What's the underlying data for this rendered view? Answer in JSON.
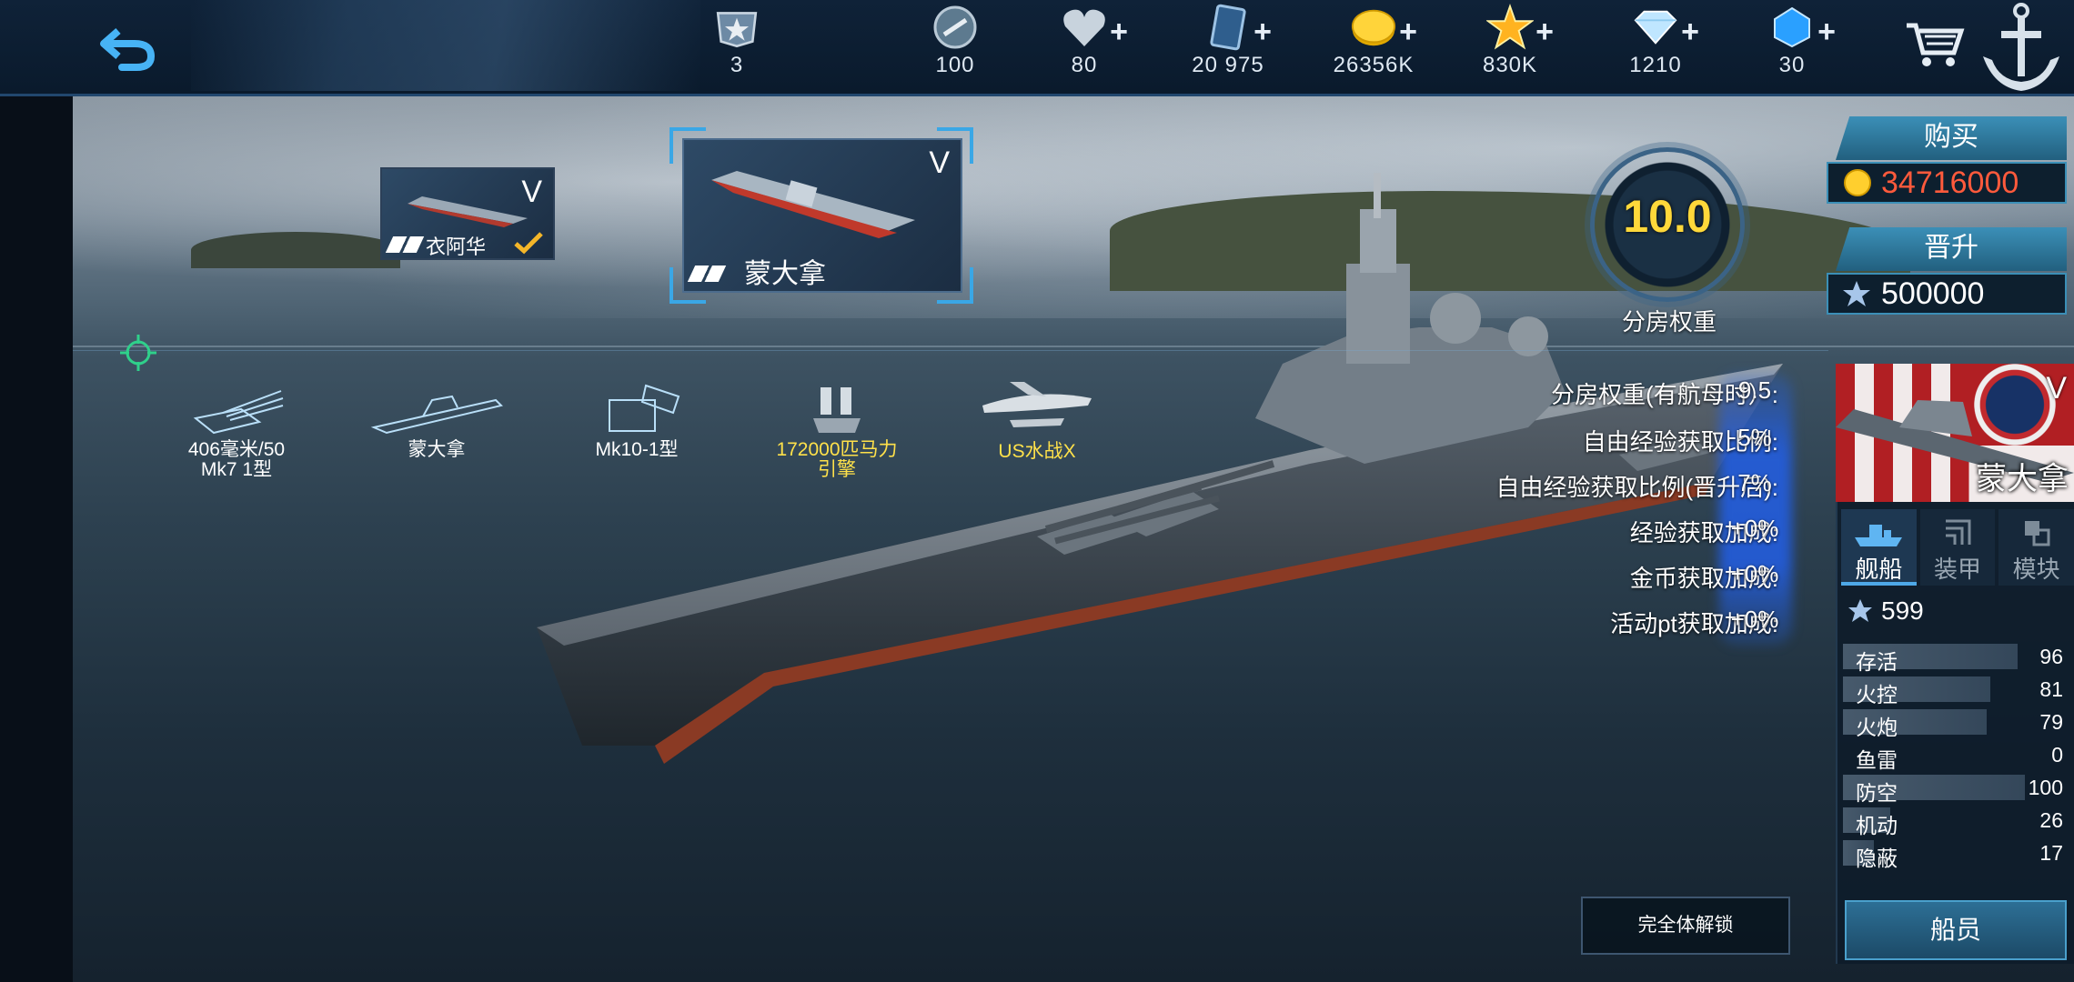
{
  "topbar": {
    "resources": [
      {
        "name": "rank",
        "value": "3",
        "plus": false
      },
      {
        "name": "medal",
        "value": "100",
        "plus": false
      },
      {
        "name": "heart",
        "value": "80",
        "plus": true
      },
      {
        "name": "card",
        "value": "20 975",
        "plus": true
      },
      {
        "name": "gold",
        "value": "26356K",
        "plus": true
      },
      {
        "name": "star",
        "value": "830K",
        "plus": true
      },
      {
        "name": "diamond",
        "value": "1210",
        "plus": true
      },
      {
        "name": "crystal",
        "value": "30",
        "plus": true
      }
    ]
  },
  "ships": {
    "secondary": {
      "name": "衣阿华",
      "tier": "V"
    },
    "selected": {
      "name": "蒙大拿",
      "tier": "V"
    }
  },
  "equipment": [
    {
      "label": "406毫米/50\nMk7 1型",
      "color": "#ffffff"
    },
    {
      "label": "蒙大拿",
      "color": "#ffffff"
    },
    {
      "label": "Mk10-1型",
      "color": "#ffffff"
    },
    {
      "label": "172000匹马力\n引擎",
      "color": "#ffe14a"
    },
    {
      "label": "US水战X",
      "color": "#ffe14a"
    }
  ],
  "weight": {
    "value": "10.0",
    "label": "分房权重"
  },
  "stats": [
    {
      "label": "分房权重(有航母时）:",
      "value": "9.5"
    },
    {
      "label": "自由经验获取比例:",
      "value": "5%"
    },
    {
      "label": "自由经验获取比例(晋升后):",
      "value": "7%"
    },
    {
      "label": "经验获取加成:",
      "value": "+0%"
    },
    {
      "label": "金币获取加成:",
      "value": "+0%"
    },
    {
      "label": "活动pt获取加成:",
      "value": "+0%"
    }
  ],
  "buy": {
    "label": "购买",
    "price": "34716000"
  },
  "promote": {
    "label": "晋升",
    "price": "500000"
  },
  "panel": {
    "ship_name": "蒙大拿",
    "tier": "V",
    "tabs": [
      "舰船",
      "装甲",
      "模块"
    ],
    "star_count": "599",
    "attributes": [
      {
        "label": "存活",
        "value": "96",
        "fill": 0.96
      },
      {
        "label": "火控",
        "value": "81",
        "fill": 0.81
      },
      {
        "label": "火炮",
        "value": "79",
        "fill": 0.79
      },
      {
        "label": "鱼雷",
        "value": "0",
        "fill": 0
      },
      {
        "label": "防空",
        "value": "100",
        "fill": 1.0
      },
      {
        "label": "机动",
        "value": "26",
        "fill": 0.26
      },
      {
        "label": "隐蔽",
        "value": "17",
        "fill": 0.17
      }
    ],
    "crew_button": "船员"
  },
  "unlock_button": "完全体解锁"
}
